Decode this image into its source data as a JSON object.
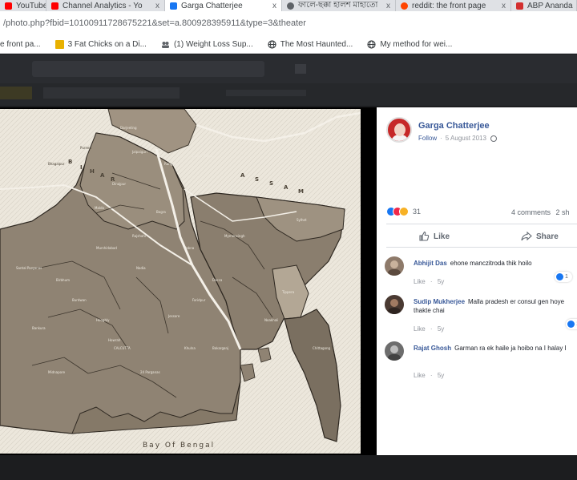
{
  "browser": {
    "tabs": [
      {
        "label": "YouTube",
        "color": "#ff0000",
        "active": false
      },
      {
        "label": "Channel Analytics - Yo",
        "color": "#ff0000",
        "active": false
      },
      {
        "label": "Garga Chatterjee",
        "color": "#1877f2",
        "active": true
      },
      {
        "label": "ফালে-ছক্কা হালশ মাহাতো",
        "color": "#5f6368",
        "active": false
      },
      {
        "label": "reddit: the front page",
        "color": "#ff4500",
        "active": false
      },
      {
        "label": "ABP Ananda",
        "color": "#d32f2f",
        "active": false
      }
    ],
    "close_glyph": "x",
    "url": {
      "main": "/photo.php?fbid=10100911728675221&set=a.800928395911&type=3&theater",
      "scheme": ""
    },
    "bookmarks": [
      {
        "label": "e front pa...",
        "icon": "reddit-icon",
        "color": "#ff4500"
      },
      {
        "label": "3 Fat Chicks on a Di...",
        "icon": "folder-icon",
        "color": "#e8b100"
      },
      {
        "label": "(1) Weight Loss Sup...",
        "icon": "facebook-group-icon",
        "color": "#5f6368"
      },
      {
        "label": "The Most Haunted...",
        "icon": "globe-icon",
        "color": "#5f6368"
      },
      {
        "label": "My method for wei...",
        "icon": "globe-icon",
        "color": "#5f6368"
      }
    ]
  },
  "map": {
    "caption": "Bay Of Bengal",
    "labels": [
      "Darjeeling",
      "Jalpaiguri",
      "Rangpur",
      "Dinajpur",
      "Rajshahi",
      "Bogra",
      "Malda",
      "Murshidabad",
      "Nadia",
      "Jessore",
      "Khulna",
      "Dacca",
      "Mymensingh",
      "Sylhet",
      "Tippera",
      "Noakhali",
      "Chittagong",
      "Bakarganj",
      "Faridpur",
      "Pabna",
      "Burdwan",
      "Birbhum",
      "Bankura",
      "Midnapore",
      "Hooghly",
      "Howrah",
      "24 Parganas",
      "CALCUTTA",
      "Santal Parganas",
      "Bhagalpur",
      "Purnea",
      "Cooch Behar"
    ]
  },
  "post": {
    "author": "Garga Chatterjee",
    "follow_label": "Follow",
    "date": "5 August 2013",
    "reaction_count": "31",
    "comment_count": "4 comments",
    "share_count": "2 sh",
    "like_label": "Like",
    "share_label": "Share",
    "accent_color": "#385898"
  },
  "comments": [
    {
      "name": "Abhijit Das",
      "text": "ehone manczitroda thik hoilo",
      "like": "Like",
      "time": "5y",
      "reactions": "1",
      "avatar_color": "#8e7a6a"
    },
    {
      "name": "Sudip Mukherjee",
      "text": "Malla pradesh er consul gen hoye thakte chai",
      "like": "Like",
      "time": "5y",
      "reactions": "1",
      "avatar_color": "#4a3a32"
    },
    {
      "name": "Rajat Ghosh",
      "text": "Garman ra ek haile ja hoibo na I halay I",
      "like": "Like",
      "time": "5y",
      "reactions": "",
      "avatar_color": "#6d6d6d"
    }
  ]
}
